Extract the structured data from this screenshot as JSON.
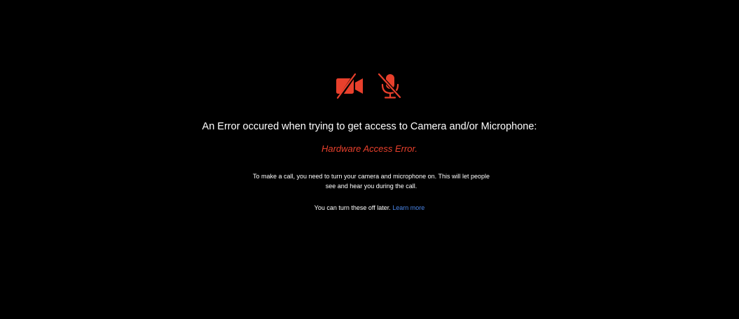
{
  "colors": {
    "background": "#000000",
    "text": "#ffffff",
    "error": "#e8402c",
    "link": "#4a86e8"
  },
  "icons": [
    "camera-off-icon",
    "microphone-off-icon"
  ],
  "error": {
    "headline": "An Error occured when trying to get access to Camera and/or Microphone:",
    "name": "Hardware Access Error."
  },
  "message": {
    "description": "To make a call, you need to turn your camera and microphone on. This will let people see and hear you during the call.",
    "footnote": "You can turn these off later.",
    "learn_more": "Learn more"
  }
}
